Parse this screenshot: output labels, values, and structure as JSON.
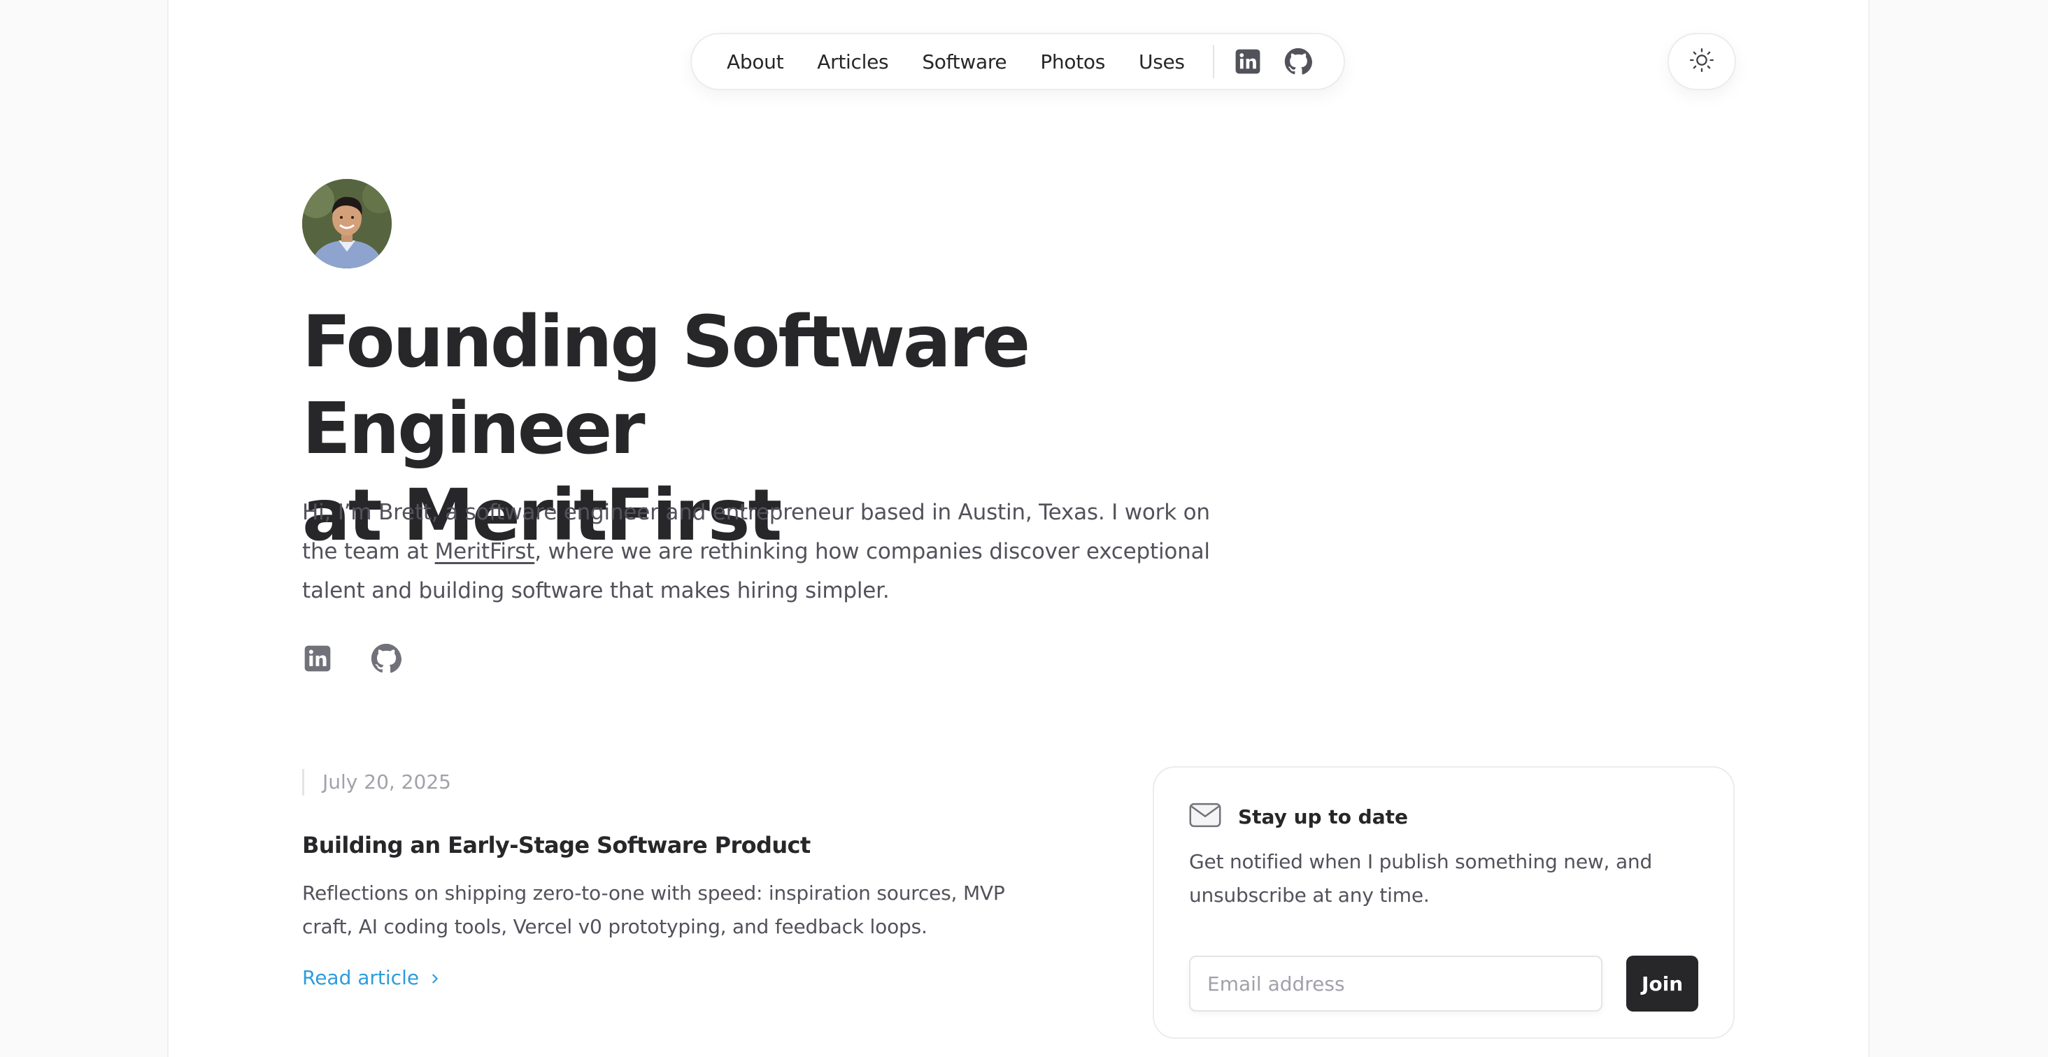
{
  "nav": {
    "items": [
      {
        "label": "About"
      },
      {
        "label": "Articles"
      },
      {
        "label": "Software"
      },
      {
        "label": "Photos"
      },
      {
        "label": "Uses"
      }
    ],
    "icons": [
      "linkedin-icon",
      "github-icon"
    ]
  },
  "theme_toggle": {
    "icon": "sun-icon"
  },
  "hero": {
    "headline_line1": "Founding Software Engineer",
    "headline_line2": "at MeritFirst",
    "intro_before": "Hi, I’m Brett, a software engineer and entrepreneur based in Austin, Texas. I work on the team at ",
    "intro_link": "MeritFirst",
    "intro_after": ", where we are rethinking how companies discover exceptional talent and building software that makes hiring simpler."
  },
  "social": {
    "icons": [
      "linkedin-icon",
      "github-icon"
    ]
  },
  "article": {
    "date": "July 20, 2025",
    "title": "Building an Early-Stage Software Product",
    "description": "Reflections on shipping zero-to-one with speed: inspiration sources, MVP craft, AI coding tools, Vercel v0 prototyping, and feedback loops.",
    "cta": "Read article"
  },
  "newsletter": {
    "title": "Stay up to date",
    "description": "Get notified when I publish something new, and unsubscribe at any time.",
    "placeholder": "Email address",
    "button": "Join"
  },
  "colors": {
    "accent": "#2d9cdb",
    "text": "#27272a",
    "muted": "#52525b"
  }
}
